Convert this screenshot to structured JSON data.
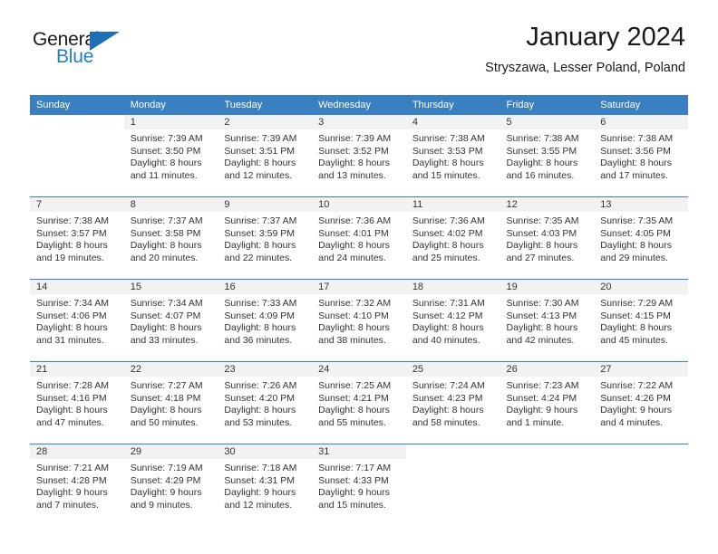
{
  "brand": {
    "word_one": "General",
    "word_two": "Blue",
    "triangle_icon": "triangle-icon"
  },
  "header": {
    "title": "January 2024",
    "subtitle": "Stryszawa, Lesser Poland, Poland"
  },
  "colors": {
    "header_blue": "#3a7fc1",
    "brand_blue": "#1f7fc4",
    "daynum_band": "#f2f2f2",
    "text": "#333333"
  },
  "weekdays": [
    "Sunday",
    "Monday",
    "Tuesday",
    "Wednesday",
    "Thursday",
    "Friday",
    "Saturday"
  ],
  "weeks": [
    [
      {
        "day": "",
        "blank": true,
        "sunrise": "",
        "sunset": "",
        "daylight_1": "",
        "daylight_2": ""
      },
      {
        "day": "1",
        "sunrise": "Sunrise: 7:39 AM",
        "sunset": "Sunset: 3:50 PM",
        "daylight_1": "Daylight: 8 hours",
        "daylight_2": "and 11 minutes."
      },
      {
        "day": "2",
        "sunrise": "Sunrise: 7:39 AM",
        "sunset": "Sunset: 3:51 PM",
        "daylight_1": "Daylight: 8 hours",
        "daylight_2": "and 12 minutes."
      },
      {
        "day": "3",
        "sunrise": "Sunrise: 7:39 AM",
        "sunset": "Sunset: 3:52 PM",
        "daylight_1": "Daylight: 8 hours",
        "daylight_2": "and 13 minutes."
      },
      {
        "day": "4",
        "sunrise": "Sunrise: 7:38 AM",
        "sunset": "Sunset: 3:53 PM",
        "daylight_1": "Daylight: 8 hours",
        "daylight_2": "and 15 minutes."
      },
      {
        "day": "5",
        "sunrise": "Sunrise: 7:38 AM",
        "sunset": "Sunset: 3:55 PM",
        "daylight_1": "Daylight: 8 hours",
        "daylight_2": "and 16 minutes."
      },
      {
        "day": "6",
        "sunrise": "Sunrise: 7:38 AM",
        "sunset": "Sunset: 3:56 PM",
        "daylight_1": "Daylight: 8 hours",
        "daylight_2": "and 17 minutes."
      }
    ],
    [
      {
        "day": "7",
        "sunrise": "Sunrise: 7:38 AM",
        "sunset": "Sunset: 3:57 PM",
        "daylight_1": "Daylight: 8 hours",
        "daylight_2": "and 19 minutes."
      },
      {
        "day": "8",
        "sunrise": "Sunrise: 7:37 AM",
        "sunset": "Sunset: 3:58 PM",
        "daylight_1": "Daylight: 8 hours",
        "daylight_2": "and 20 minutes."
      },
      {
        "day": "9",
        "sunrise": "Sunrise: 7:37 AM",
        "sunset": "Sunset: 3:59 PM",
        "daylight_1": "Daylight: 8 hours",
        "daylight_2": "and 22 minutes."
      },
      {
        "day": "10",
        "sunrise": "Sunrise: 7:36 AM",
        "sunset": "Sunset: 4:01 PM",
        "daylight_1": "Daylight: 8 hours",
        "daylight_2": "and 24 minutes."
      },
      {
        "day": "11",
        "sunrise": "Sunrise: 7:36 AM",
        "sunset": "Sunset: 4:02 PM",
        "daylight_1": "Daylight: 8 hours",
        "daylight_2": "and 25 minutes."
      },
      {
        "day": "12",
        "sunrise": "Sunrise: 7:35 AM",
        "sunset": "Sunset: 4:03 PM",
        "daylight_1": "Daylight: 8 hours",
        "daylight_2": "and 27 minutes."
      },
      {
        "day": "13",
        "sunrise": "Sunrise: 7:35 AM",
        "sunset": "Sunset: 4:05 PM",
        "daylight_1": "Daylight: 8 hours",
        "daylight_2": "and 29 minutes."
      }
    ],
    [
      {
        "day": "14",
        "sunrise": "Sunrise: 7:34 AM",
        "sunset": "Sunset: 4:06 PM",
        "daylight_1": "Daylight: 8 hours",
        "daylight_2": "and 31 minutes."
      },
      {
        "day": "15",
        "sunrise": "Sunrise: 7:34 AM",
        "sunset": "Sunset: 4:07 PM",
        "daylight_1": "Daylight: 8 hours",
        "daylight_2": "and 33 minutes."
      },
      {
        "day": "16",
        "sunrise": "Sunrise: 7:33 AM",
        "sunset": "Sunset: 4:09 PM",
        "daylight_1": "Daylight: 8 hours",
        "daylight_2": "and 36 minutes."
      },
      {
        "day": "17",
        "sunrise": "Sunrise: 7:32 AM",
        "sunset": "Sunset: 4:10 PM",
        "daylight_1": "Daylight: 8 hours",
        "daylight_2": "and 38 minutes."
      },
      {
        "day": "18",
        "sunrise": "Sunrise: 7:31 AM",
        "sunset": "Sunset: 4:12 PM",
        "daylight_1": "Daylight: 8 hours",
        "daylight_2": "and 40 minutes."
      },
      {
        "day": "19",
        "sunrise": "Sunrise: 7:30 AM",
        "sunset": "Sunset: 4:13 PM",
        "daylight_1": "Daylight: 8 hours",
        "daylight_2": "and 42 minutes."
      },
      {
        "day": "20",
        "sunrise": "Sunrise: 7:29 AM",
        "sunset": "Sunset: 4:15 PM",
        "daylight_1": "Daylight: 8 hours",
        "daylight_2": "and 45 minutes."
      }
    ],
    [
      {
        "day": "21",
        "sunrise": "Sunrise: 7:28 AM",
        "sunset": "Sunset: 4:16 PM",
        "daylight_1": "Daylight: 8 hours",
        "daylight_2": "and 47 minutes."
      },
      {
        "day": "22",
        "sunrise": "Sunrise: 7:27 AM",
        "sunset": "Sunset: 4:18 PM",
        "daylight_1": "Daylight: 8 hours",
        "daylight_2": "and 50 minutes."
      },
      {
        "day": "23",
        "sunrise": "Sunrise: 7:26 AM",
        "sunset": "Sunset: 4:20 PM",
        "daylight_1": "Daylight: 8 hours",
        "daylight_2": "and 53 minutes."
      },
      {
        "day": "24",
        "sunrise": "Sunrise: 7:25 AM",
        "sunset": "Sunset: 4:21 PM",
        "daylight_1": "Daylight: 8 hours",
        "daylight_2": "and 55 minutes."
      },
      {
        "day": "25",
        "sunrise": "Sunrise: 7:24 AM",
        "sunset": "Sunset: 4:23 PM",
        "daylight_1": "Daylight: 8 hours",
        "daylight_2": "and 58 minutes."
      },
      {
        "day": "26",
        "sunrise": "Sunrise: 7:23 AM",
        "sunset": "Sunset: 4:24 PM",
        "daylight_1": "Daylight: 9 hours",
        "daylight_2": "and 1 minute."
      },
      {
        "day": "27",
        "sunrise": "Sunrise: 7:22 AM",
        "sunset": "Sunset: 4:26 PM",
        "daylight_1": "Daylight: 9 hours",
        "daylight_2": "and 4 minutes."
      }
    ],
    [
      {
        "day": "28",
        "sunrise": "Sunrise: 7:21 AM",
        "sunset": "Sunset: 4:28 PM",
        "daylight_1": "Daylight: 9 hours",
        "daylight_2": "and 7 minutes."
      },
      {
        "day": "29",
        "sunrise": "Sunrise: 7:19 AM",
        "sunset": "Sunset: 4:29 PM",
        "daylight_1": "Daylight: 9 hours",
        "daylight_2": "and 9 minutes."
      },
      {
        "day": "30",
        "sunrise": "Sunrise: 7:18 AM",
        "sunset": "Sunset: 4:31 PM",
        "daylight_1": "Daylight: 9 hours",
        "daylight_2": "and 12 minutes."
      },
      {
        "day": "31",
        "sunrise": "Sunrise: 7:17 AM",
        "sunset": "Sunset: 4:33 PM",
        "daylight_1": "Daylight: 9 hours",
        "daylight_2": "and 15 minutes."
      },
      {
        "day": "",
        "blank": true,
        "sunrise": "",
        "sunset": "",
        "daylight_1": "",
        "daylight_2": ""
      },
      {
        "day": "",
        "blank": true,
        "sunrise": "",
        "sunset": "",
        "daylight_1": "",
        "daylight_2": ""
      },
      {
        "day": "",
        "blank": true,
        "sunrise": "",
        "sunset": "",
        "daylight_1": "",
        "daylight_2": ""
      }
    ]
  ]
}
